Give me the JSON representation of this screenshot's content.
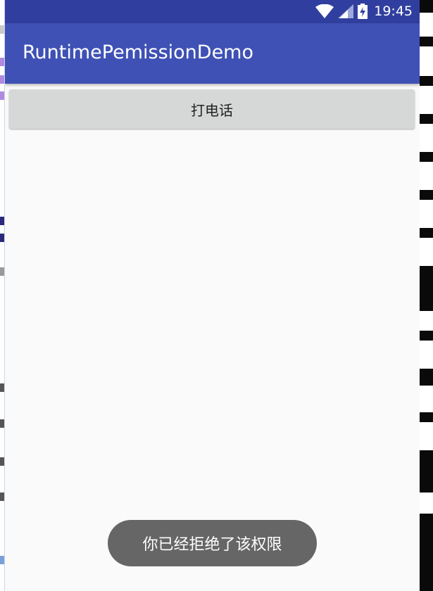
{
  "status_bar": {
    "time": "19:45",
    "icons": [
      "wifi-icon",
      "signal-icon",
      "battery-charging-icon"
    ],
    "color": "#303f9f"
  },
  "app_bar": {
    "title": "RuntimePemissionDemo",
    "color": "#3f51b5"
  },
  "main": {
    "call_button_label": "打电话"
  },
  "toast": {
    "message": "你已经拒绝了该权限"
  }
}
